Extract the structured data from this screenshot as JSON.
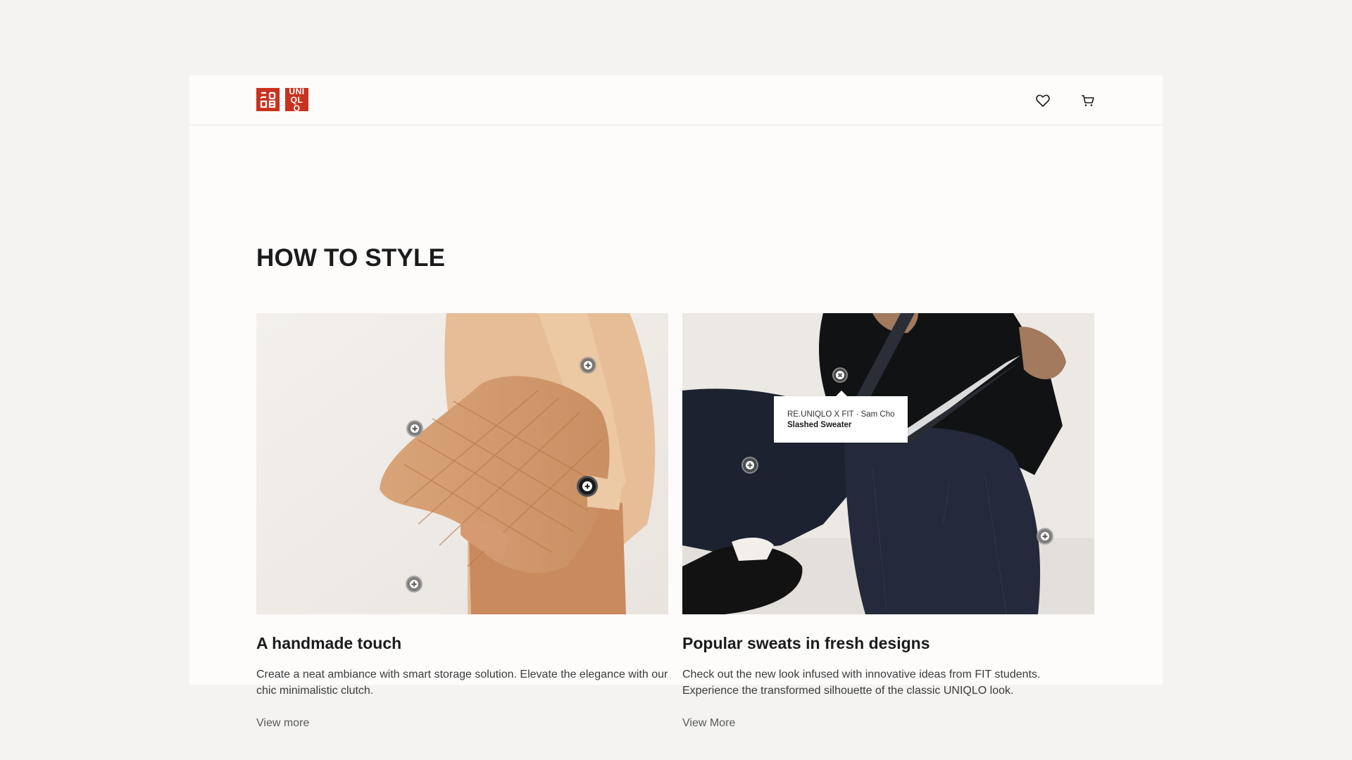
{
  "brand": {
    "logo_left_text": "ユニクロ",
    "logo_right_text": "UNIQLO",
    "color": "#c8321f"
  },
  "header": {
    "icons": [
      "heart-icon",
      "cart-icon"
    ]
  },
  "section": {
    "title": "HOW TO STYLE"
  },
  "cards": [
    {
      "title": "A handmade touch",
      "description": "Create a neat ambiance with smart storage solution. Elevate the elegance with our chic minimalistic clutch.",
      "link": "View more",
      "hotspot_count": 4
    },
    {
      "title": "Popular sweats in fresh designs",
      "description": "Check out the new look infused with innovative ideas from FIT students. Experience the transformed silhouette of the classic UNIQLO look.",
      "link": "View More",
      "hotspot_count": 3,
      "tooltip": {
        "brand": "RE.UNIQLO X FIT · Sam Cho",
        "product": "Slashed Sweater"
      }
    }
  ]
}
